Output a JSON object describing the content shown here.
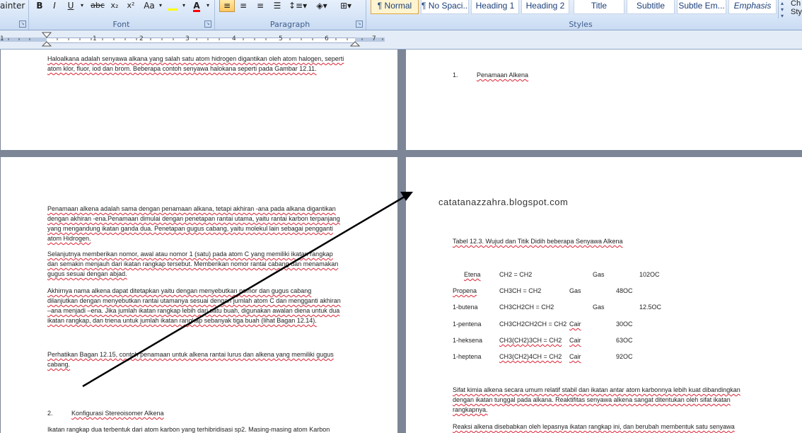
{
  "ribbon": {
    "clipboard_fragment": "ainter",
    "font_group_label": "Font",
    "paragraph_group_label": "Paragraph",
    "styles_group_label": "Styles",
    "font_buttons": [
      "B",
      "I",
      "U",
      "abc",
      "x₂",
      "x²",
      "Aa"
    ],
    "styles": [
      "¶ Normal",
      "¶ No Spaci...",
      "Heading 1",
      "Heading 2",
      "Title",
      "Subtitle",
      "Subtle Em...",
      "Emphasis"
    ],
    "change_styles_fragment": [
      "Ch",
      "Sty"
    ]
  },
  "ruler": {
    "numbers": [
      "1",
      "1",
      "2",
      "3",
      "4",
      "5",
      "6",
      "7"
    ]
  },
  "page_top_left": {
    "line1": "Haloalkana adalah senyawa alkana yang salah satu atom hidrogen digantikan oleh atom halogen, seperti",
    "line2": "atom klor, fluor, iod dan brom. Beberapa contoh senyawa halokana seperti pada Gambar 12.11."
  },
  "page_top_right": {
    "list_number": "1.",
    "list_text": "Penamaan Alkena"
  },
  "page_bottom_left": {
    "p1": [
      "Penamaan alkena adalah sama dengan penamaan alkana, tetapi akhiran -ana pada alkana digantikan",
      "dengan akhiran -ena.Penamaan dimulai  dengan penetapan  rantai utama,  yaitu rantai karbon terpanjang",
      "yang mengandung ikatan ganda dua. Penetapan gugus cabang, yaitu molekul lain sebagai pengganti",
      "atom Hidrogen."
    ],
    "p2": [
      "Selanjutnya memberikan nomor, awal atau nomor 1 (satu) pada atom C yang memiliki ikatan rangkap",
      "dan semakin menjauh dari ikatan rangkap tersebut. Memberikan nomor  rantai cabang dan menamakan",
      "gugus sesuai dengan abjad."
    ],
    "p3": [
      "Akhirnya nama alkena dapat ditetapkan yaitu dengan menyebutkan nomor dan gugus cabang",
      "dilanjutkan dengan menyebutkan rantai utamanya sesuai dengan jumlah atom C dan mengganti akhiran",
      "–ana menjadi –ena. Jika jumlah ikatan rangkap lebih dari satu buah, digunakan awalan diena  untuk  dua",
      "ikatan rangkap, dan  triena untuk jumlah  ikatan rangkap sebanyak tiga buah (lihat Bagan 12.14)."
    ],
    "p4": [
      "Perhatikan Bagan 12.15, contoh penamaan untuk alkena rantai lurus dan alkena yang memiliki gugus",
      "cabang."
    ],
    "list_number": "2.",
    "list_text": "Konfigurasi Stereoisomer Alkena",
    "p5": "Ikatan rangkap dua terbentuk dari atom karbon yang terhibridisasi sp2. Masing-masing atom Karbon"
  },
  "page_bottom_right": {
    "watermark": "catatanazzahra.blogspot.com",
    "table_caption": "Tabel 12.3. Wujud dan Titik Didih  beberapa Senyawa Alkena",
    "rows": [
      {
        "name": "Etena",
        "formula": "CH2 = CH2",
        "phase": "Gas",
        "bp": "102OC"
      },
      {
        "name": "Propena",
        "formula": "CH3CH = CH2",
        "phase": "Gas",
        "bp": "48OC"
      },
      {
        "name": "1-butena",
        "formula": "CH3CH2CH = CH2",
        "phase": "Gas",
        "bp": "12.5OC"
      },
      {
        "name": "1-pentena",
        "formula": "CH3CH2CH2CH  = CH2",
        "phase": "Cair",
        "bp": "30OC"
      },
      {
        "name": "1-heksena",
        "formula": "CH3(CH2)3CH  = CH2",
        "phase": "Cair",
        "bp": "63OC"
      },
      {
        "name": "1-heptena",
        "formula": "CH3(CH2)4CH  = CH2",
        "phase": "Cair",
        "bp": "92OC"
      }
    ],
    "p1": [
      "Sifat kimia alkena secara umum relatif stabil dan ikatan antar atom karbonnya lebih kuat dibandingkan",
      "dengan ikatan tunggal pada alkana. Reaktifitas senyawa alkena sangat ditentukan oleh sifat ikatan",
      "rangkapnya."
    ],
    "p2": "Reaksi alkena disebabkan oleh lepasnya ikatan rangkap ini, dan berubah membentuk satu senyawa"
  },
  "colors": {
    "highlight": "#ffff00",
    "font_color": "#ff0000",
    "annotation_arrow": "#000000"
  }
}
